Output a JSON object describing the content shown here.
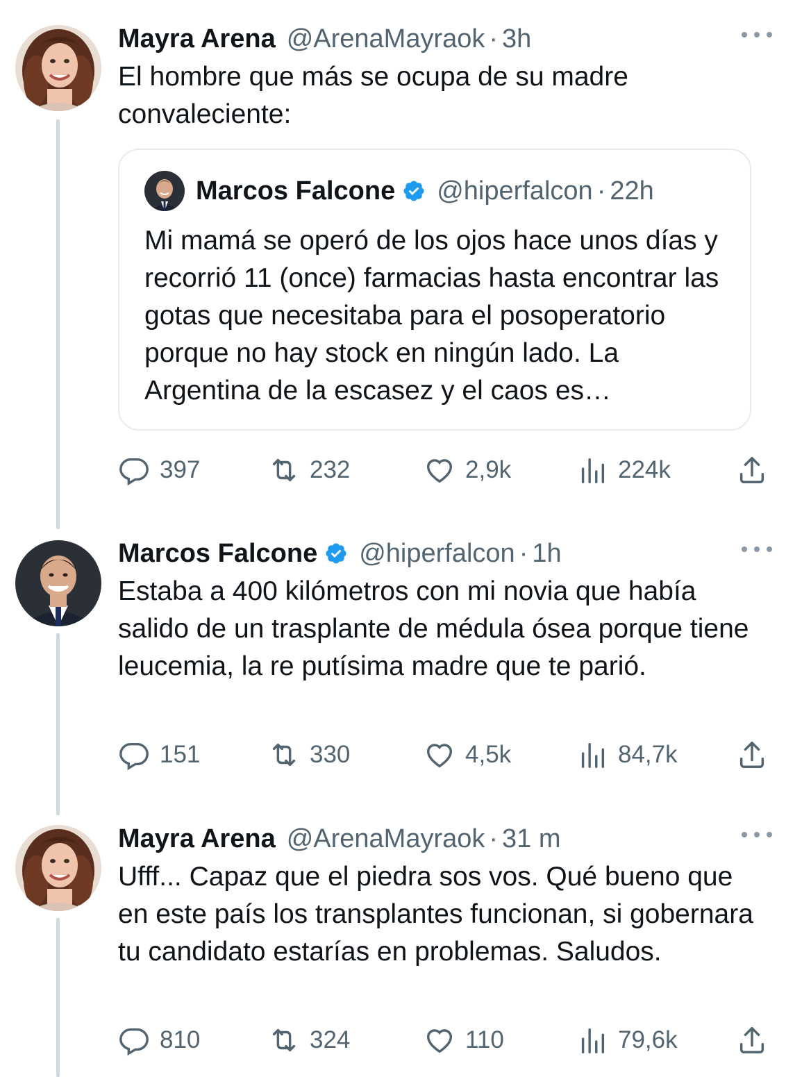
{
  "tweets": [
    {
      "author": "Mayra Arena",
      "handle": "@ArenaMayraok",
      "separator": "·",
      "time": "3h",
      "avatar": "woman-curly-hair-avatar",
      "text": "El hombre que más se ocupa de su madre convaleciente:",
      "quote": {
        "author": "Marcos Falcone",
        "handle": "@hiperfalcon",
        "separator": "·",
        "time": "22h",
        "verified": true,
        "text": "Mi mamá se operó de los ojos hace unos días y recorrió 11 (once) farmacias hasta encontrar las gotas que necesitaba para el posoperatorio porque no hay stock en ningún lado. La Argentina de la escasez y el caos es…"
      },
      "stats": {
        "replies": "397",
        "retweets": "232",
        "likes": "2,9k",
        "views": "224k"
      }
    },
    {
      "author": "Marcos Falcone",
      "handle": "@hiperfalcon",
      "separator": "·",
      "time": "1h",
      "verified": true,
      "avatar": "man-suit-avatar",
      "text": "Estaba a 400 kilómetros con mi novia que había salido de un trasplante de médula ósea porque tiene leucemia, la re putísima madre que te parió.",
      "stats": {
        "replies": "151",
        "retweets": "330",
        "likes": "4,5k",
        "views": "84,7k"
      }
    },
    {
      "author": "Mayra Arena",
      "handle": "@ArenaMayraok",
      "separator": "·",
      "time": "31 m",
      "avatar": "woman-curly-hair-avatar",
      "text": "Ufff... Capaz que el piedra sos vos. Qué bueno que en este país los transplantes funcionan, si gobernara tu candidato estarías en problemas. Saludos.",
      "stats": {
        "replies": "810",
        "retweets": "324",
        "likes": "110",
        "views": "79,6k"
      }
    }
  ],
  "icons": {
    "reply": "reply-icon",
    "retweet": "retweet-icon",
    "like": "heart-icon",
    "views": "views-icon",
    "share": "share-icon",
    "verified": "verified-badge-icon",
    "more": "more-options-icon"
  },
  "colors": {
    "text": "#0f1419",
    "secondary": "#536471",
    "verified": "#1d9bf0",
    "thread_line": "#cfd9de"
  }
}
